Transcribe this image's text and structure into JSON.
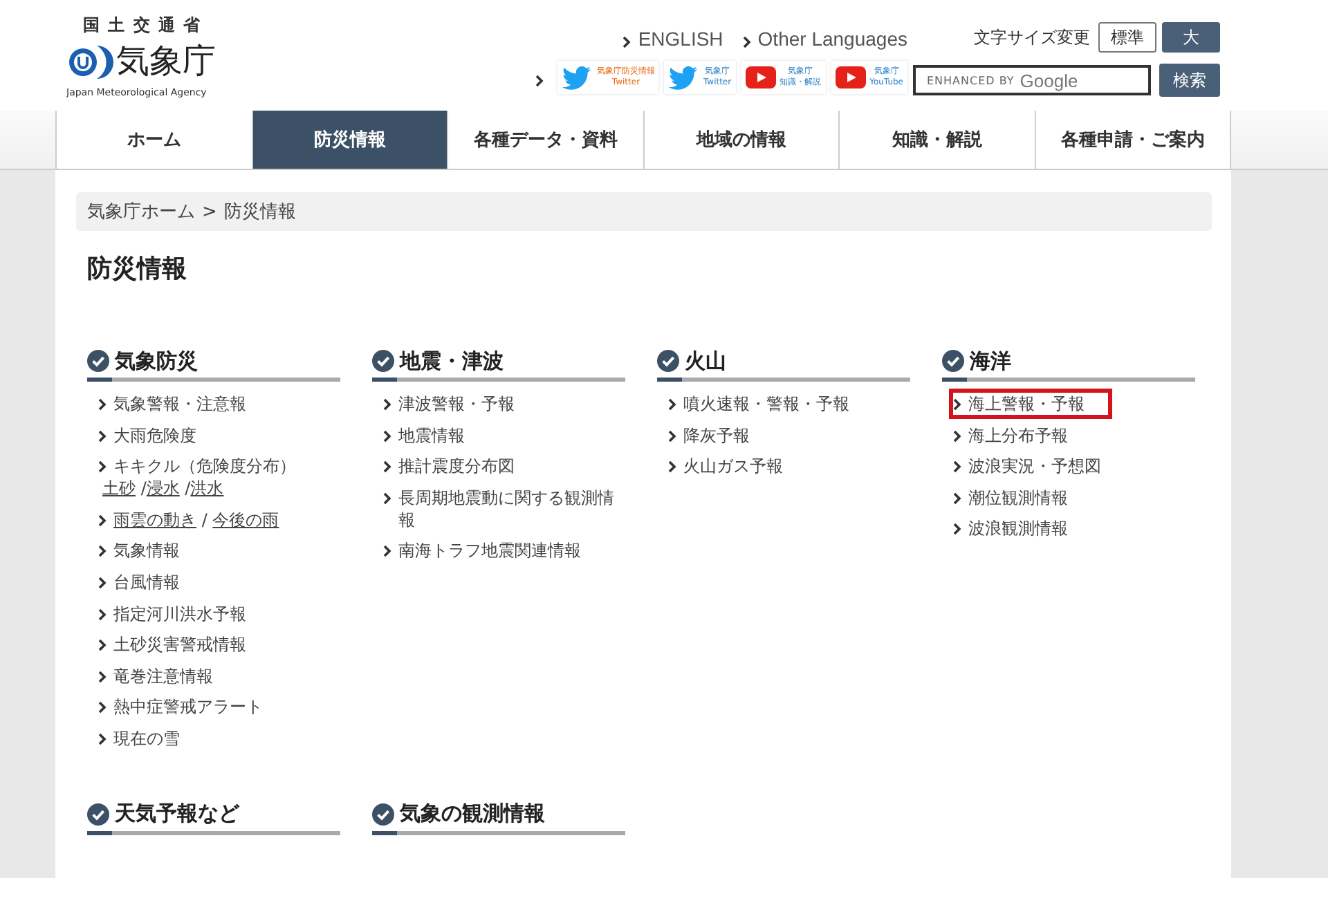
{
  "header": {
    "ministry": "国 土 交 通 省",
    "agency": "気象庁",
    "agency_en": "Japan Meteorological Agency",
    "lang_links": [
      "ENGLISH",
      "Other Languages"
    ],
    "font_size": {
      "label": "文字サイズ変更",
      "options": [
        {
          "label": "標準",
          "selected": false
        },
        {
          "label": "大",
          "selected": true
        }
      ]
    },
    "social": [
      {
        "kind": "twitter",
        "lines": [
          "気象庁防災情報",
          "Twitter"
        ],
        "color": "#e8650a"
      },
      {
        "kind": "twitter",
        "lines": [
          "気象庁",
          "Twitter"
        ],
        "color": "#2a7fc6"
      },
      {
        "kind": "youtube",
        "lines": [
          "気象庁",
          "知識・解説"
        ],
        "color": "#2a7fc6"
      },
      {
        "kind": "youtube",
        "lines": [
          "気象庁",
          "YouTube"
        ],
        "color": "#2a7fc6"
      }
    ],
    "search": {
      "placeholder_prefix": "ENHANCED BY",
      "placeholder_brand": "Google",
      "button": "検索"
    }
  },
  "nav": [
    {
      "label": "ホーム",
      "selected": false
    },
    {
      "label": "防災情報",
      "selected": true
    },
    {
      "label": "各種データ・資料",
      "selected": false
    },
    {
      "label": "地域の情報",
      "selected": false
    },
    {
      "label": "知識・解説",
      "selected": false
    },
    {
      "label": "各種申請・ご案内",
      "selected": false
    }
  ],
  "breadcrumb": [
    "気象庁ホーム",
    "防災情報"
  ],
  "breadcrumb_separator": ">",
  "page_title": "防災情報",
  "sections": [
    {
      "title": "気象防災",
      "items": [
        {
          "kind": "plain",
          "text": "気象警報・注意報",
          "highlighted": false
        },
        {
          "kind": "plain",
          "text": "大雨危険度",
          "highlighted": false
        },
        {
          "kind": "titled_links",
          "text": "キキクル（危険度分布）",
          "parts": [
            {
              "text": "土砂",
              "link": true
            },
            {
              "text": " /",
              "link": false
            },
            {
              "text": "浸水",
              "link": true
            },
            {
              "text": " /",
              "link": false
            },
            {
              "text": "洪水",
              "link": true
            }
          ],
          "highlighted": false
        },
        {
          "kind": "links",
          "parts": [
            {
              "text": "雨雲の動き",
              "link": true
            },
            {
              "text": " / ",
              "link": false
            },
            {
              "text": "今後の雨",
              "link": true
            }
          ],
          "highlighted": false
        },
        {
          "kind": "plain",
          "text": "気象情報",
          "highlighted": false
        },
        {
          "kind": "plain",
          "text": "台風情報",
          "highlighted": false
        },
        {
          "kind": "plain",
          "text": "指定河川洪水予報",
          "highlighted": false
        },
        {
          "kind": "plain",
          "text": "土砂災害警戒情報",
          "highlighted": false
        },
        {
          "kind": "plain",
          "text": "竜巻注意情報",
          "highlighted": false
        },
        {
          "kind": "plain",
          "text": "熱中症警戒アラート",
          "highlighted": false
        },
        {
          "kind": "plain",
          "text": "現在の雪",
          "highlighted": false
        }
      ]
    },
    {
      "title": "地震・津波",
      "items": [
        {
          "kind": "plain",
          "text": "津波警報・予報",
          "highlighted": false
        },
        {
          "kind": "plain",
          "text": "地震情報",
          "highlighted": false
        },
        {
          "kind": "plain",
          "text": "推計震度分布図",
          "highlighted": false
        },
        {
          "kind": "plain",
          "text": "長周期地震動に関する観測情報",
          "highlighted": false
        },
        {
          "kind": "plain",
          "text": "南海トラフ地震関連情報",
          "highlighted": false
        }
      ]
    },
    {
      "title": "火山",
      "items": [
        {
          "kind": "plain",
          "text": "噴火速報・警報・予報",
          "highlighted": false
        },
        {
          "kind": "plain",
          "text": "降灰予報",
          "highlighted": false
        },
        {
          "kind": "plain",
          "text": "火山ガス予報",
          "highlighted": false
        }
      ]
    },
    {
      "title": "海洋",
      "items": [
        {
          "kind": "plain",
          "text": "海上警報・予報",
          "highlighted": true
        },
        {
          "kind": "plain",
          "text": "海上分布予報",
          "highlighted": false
        },
        {
          "kind": "plain",
          "text": "波浪実況・予想図",
          "highlighted": false
        },
        {
          "kind": "plain",
          "text": "潮位観測情報",
          "highlighted": false
        },
        {
          "kind": "plain",
          "text": "波浪観測情報",
          "highlighted": false
        }
      ]
    },
    {
      "title": "天気予報など"
    },
    {
      "title": "気象の観測情報"
    }
  ]
}
